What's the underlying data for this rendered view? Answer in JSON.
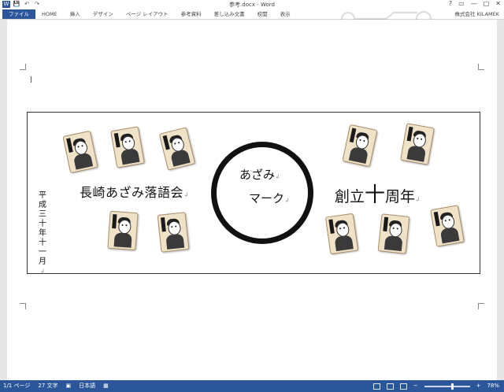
{
  "window": {
    "title": "参考.docx - Word",
    "controls": [
      "?",
      "▭",
      "—",
      "□",
      "✕"
    ]
  },
  "quick_access": {
    "save_icon": "save-icon",
    "undo_icon": "undo-icon",
    "redo_icon": "redo-icon"
  },
  "ribbon": {
    "tabs": [
      "ファイル",
      "HOME",
      "挿入",
      "デザイン",
      "ページ レイアウト",
      "参考資料",
      "差し込み文書",
      "校閲",
      "表示"
    ],
    "account": "株式会社 KILAMEK"
  },
  "document": {
    "group_name": "長崎あざみ落語会",
    "anniversary_pre": "創立",
    "anniversary_big": "十",
    "anniversary_post": "周年",
    "date_vertical": "平成三十年十一月",
    "mark_line1": "あざみ",
    "mark_line2": "マーク",
    "para_mark": "↲"
  },
  "status": {
    "page": "1/1 ページ",
    "words": "27 文字",
    "language": "日本語",
    "zoom": "78%",
    "zoom_minus": "−",
    "zoom_plus": "+",
    "zoom_level": 0.78
  }
}
